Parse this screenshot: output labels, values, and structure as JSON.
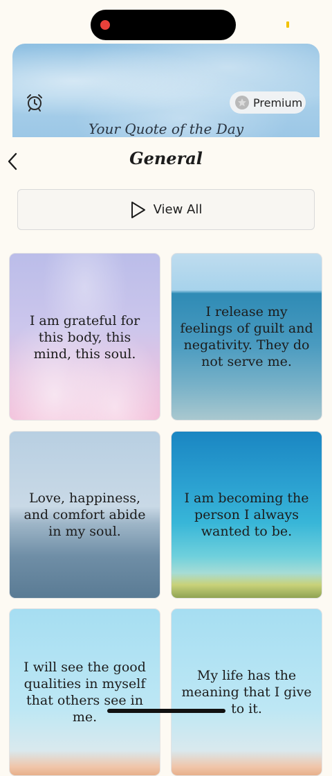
{
  "hero": {
    "caption": "Your Quote of the Day",
    "premium_label": "Premium"
  },
  "header": {
    "title": "General"
  },
  "view_all": {
    "label": "View All"
  },
  "cards": [
    {
      "text": "I am grateful for this body, this mind, this soul."
    },
    {
      "text": "I release my feelings of guilt and negativity. They do not serve me."
    },
    {
      "text": "Love, happiness, and comfort abide in my soul."
    },
    {
      "text": "I am becoming the person I always wanted to be."
    },
    {
      "text": "I will see the good qualities in myself that others see in me."
    },
    {
      "text": "My life has the meaning that I give to it."
    }
  ],
  "icons": {
    "alarm": "alarm-clock-icon",
    "premium_star": "star-icon",
    "back": "chevron-left-icon",
    "play": "play-icon"
  },
  "colors": {
    "background": "#fdfaf3",
    "text": "#1c1c1c"
  }
}
